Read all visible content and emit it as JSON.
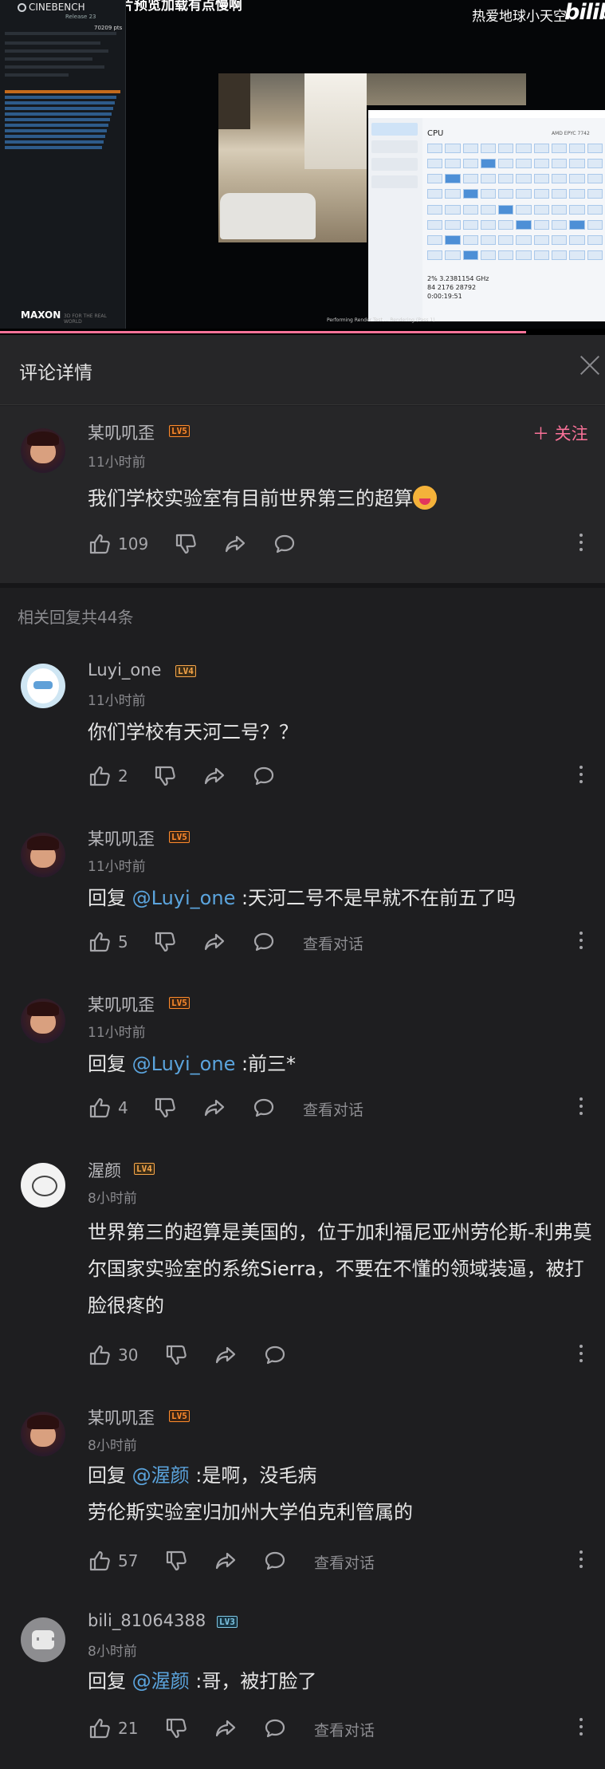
{
  "video": {
    "top_text": "所选图片预览加载有点慢啊",
    "uploader": "热爱地球小天空",
    "logo_text": "bilibili",
    "cinebench": {
      "title": "CINEBENCH",
      "subtitle": "Release 23",
      "score": "70209 pts",
      "brand": "MAXON",
      "footer": "3D FOR THE REAL WORLD"
    },
    "taskmanager": {
      "heading": "CPU",
      "cpu_model": "AMD EPYC 7742",
      "stats": [
        "2%   3.2381154 GHz",
        "84   2176   28792",
        "0:00:19:51"
      ]
    },
    "caption": "Performing Render Test ... Rendering (Pass 1)",
    "progress_fraction": 0.87,
    "progress_color": "#fb7299"
  },
  "sheet": {
    "title": "评论详情",
    "close_icon": "close-icon",
    "follow_label": "＋ 关注",
    "replies_header": "相关回复共44条"
  },
  "main_comment": {
    "user": "某叽叽歪",
    "level": "LV5",
    "time": "11小时前",
    "text": "我们学校实验室有目前世界第三的超算",
    "likes": "109"
  },
  "replies": [
    {
      "user": "Luyi_one",
      "level": "LV4",
      "time": "11小时前",
      "prefix": "",
      "mention": "",
      "text": "你们学校有天河二号？？",
      "likes": "2",
      "view_conversation": ""
    },
    {
      "user": "某叽叽歪",
      "level": "LV5",
      "time": "11小时前",
      "prefix": "回复 ",
      "mention": "@Luyi_one",
      "text": " :天河二号不是早就不在前五了吗",
      "likes": "5",
      "view_conversation": "查看对话"
    },
    {
      "user": "某叽叽歪",
      "level": "LV5",
      "time": "11小时前",
      "prefix": "回复 ",
      "mention": "@Luyi_one",
      "text": " :前三*",
      "likes": "4",
      "view_conversation": "查看对话"
    },
    {
      "user": "渥颜",
      "level": "LV4",
      "time": "8小时前",
      "prefix": "",
      "mention": "",
      "text": "世界第三的超算是美国的，位于加利福尼亚州劳伦斯-利弗莫尔国家实验室的系统Sierra，不要在不懂的领域装逼，被打脸很疼的",
      "likes": "30",
      "view_conversation": ""
    },
    {
      "user": "某叽叽歪",
      "level": "LV5",
      "time": "8小时前",
      "prefix": "回复 ",
      "mention": "@渥颜",
      "text": " :是啊，没毛病",
      "text2": "劳伦斯实验室归加州大学伯克利管属的",
      "likes": "57",
      "view_conversation": "查看对话"
    },
    {
      "user": "bili_81064388",
      "level": "LV3",
      "time": "8小时前",
      "prefix": "回复 ",
      "mention": "@渥颜",
      "text": " :哥，被打脸了",
      "likes": "21",
      "view_conversation": "查看对话"
    }
  ]
}
